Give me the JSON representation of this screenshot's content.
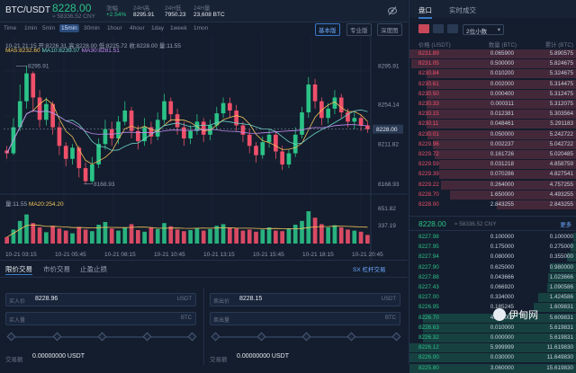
{
  "header": {
    "pair": "BTC/USDT",
    "price": "8228.00",
    "cny": "≈ 58336.52 CNY",
    "change_label": "涨幅",
    "change_value": "+2.54%",
    "high_label": "24H高",
    "high_value": "8295.91",
    "low_label": "24H低",
    "low_value": "7950.23",
    "vol_label": "24H量",
    "vol_value": "23,608 BTC",
    "icon": "eye-slash-icon"
  },
  "timeframes": [
    "Time",
    "1min",
    "5min",
    "15min",
    "30min",
    "1hour",
    "4hour",
    "1day",
    "1week",
    "1mon"
  ],
  "active_timeframe": "15min",
  "view_buttons": [
    "基本版",
    "专业版",
    "深度图"
  ],
  "active_view": "基本版",
  "chart": {
    "ohlc": "10-21 21:15  开:8226.31 高:8228.00 低:8225.72 收:8228.00 量:11.55",
    "ma5": "MA5:8232.60",
    "ma10": "MA10:8239.07",
    "ma30": "MA30:8281.51",
    "high_mark": "8295.91",
    "low_mark": "8168.93",
    "price_ticks": [
      "8295.91",
      "8254.14",
      "8211.82",
      "8168.93"
    ],
    "current_price_tag": "8228.00",
    "volume_label": "量:11.55",
    "volume_ma": "MA20:254.20",
    "volume_ticks": [
      "651.82",
      "337.19"
    ],
    "time_ticks": [
      "10-21 03:15",
      "10-21 05:45",
      "10-21 08:15",
      "10-21 10:45",
      "10-21 13:15",
      "10-21 15:45",
      "10-21 18:15",
      "10-21 20:45"
    ]
  },
  "chart_data": {
    "type": "candlestick",
    "candles": [
      [
        8205,
        8202,
        8210,
        8196
      ],
      [
        8202,
        8230,
        8240,
        8200
      ],
      [
        8230,
        8258,
        8276,
        8226
      ],
      [
        8258,
        8288,
        8296,
        8250
      ],
      [
        8288,
        8262,
        8290,
        8246
      ],
      [
        8262,
        8238,
        8270,
        8230
      ],
      [
        8238,
        8255,
        8262,
        8232
      ],
      [
        8255,
        8230,
        8258,
        8222
      ],
      [
        8230,
        8210,
        8236,
        8200
      ],
      [
        8210,
        8196,
        8214,
        8188
      ],
      [
        8196,
        8208,
        8212,
        8190
      ],
      [
        8208,
        8186,
        8210,
        8176
      ],
      [
        8186,
        8172,
        8192,
        8169
      ],
      [
        8172,
        8190,
        8198,
        8170
      ],
      [
        8190,
        8212,
        8218,
        8186
      ],
      [
        8212,
        8228,
        8238,
        8206
      ],
      [
        8228,
        8218,
        8236,
        8210
      ],
      [
        8218,
        8236,
        8242,
        8212
      ],
      [
        8236,
        8248,
        8258,
        8232
      ],
      [
        8248,
        8226,
        8252,
        8218
      ],
      [
        8226,
        8215,
        8232,
        8206
      ],
      [
        8215,
        8230,
        8240,
        8210
      ],
      [
        8230,
        8220,
        8236,
        8212
      ],
      [
        8220,
        8238,
        8246,
        8216
      ],
      [
        8238,
        8258,
        8266,
        8234
      ],
      [
        8258,
        8244,
        8262,
        8236
      ],
      [
        8244,
        8230,
        8250,
        8222
      ],
      [
        8230,
        8218,
        8236,
        8210
      ],
      [
        8218,
        8226,
        8232,
        8212
      ],
      [
        8226,
        8236,
        8244,
        8222
      ],
      [
        8236,
        8222,
        8240,
        8214
      ],
      [
        8222,
        8232,
        8238,
        8216
      ],
      [
        8232,
        8245,
        8252,
        8228
      ],
      [
        8245,
        8256,
        8262,
        8240
      ],
      [
        8256,
        8248,
        8262,
        8240
      ],
      [
        8248,
        8232,
        8254,
        8226
      ],
      [
        8232,
        8222,
        8236,
        8214
      ],
      [
        8222,
        8210,
        8228,
        8202
      ],
      [
        8210,
        8200,
        8214,
        8192
      ],
      [
        8200,
        8214,
        8220,
        8196
      ],
      [
        8214,
        8222,
        8228,
        8208
      ],
      [
        8222,
        8204,
        8226,
        8196
      ],
      [
        8204,
        8190,
        8210,
        8184
      ],
      [
        8190,
        8202,
        8206,
        8186
      ],
      [
        8202,
        8222,
        8230,
        8198
      ],
      [
        8222,
        8246,
        8252,
        8218
      ],
      [
        8246,
        8276,
        8284,
        8240
      ],
      [
        8276,
        8258,
        8282,
        8250
      ],
      [
        8258,
        8240,
        8262,
        8232
      ],
      [
        8240,
        8250,
        8256,
        8234
      ],
      [
        8250,
        8262,
        8270,
        8244
      ],
      [
        8262,
        8246,
        8266,
        8240
      ],
      [
        8246,
        8236,
        8250,
        8230
      ],
      [
        8236,
        8240,
        8246,
        8228
      ],
      [
        8240,
        8232,
        8244,
        8226
      ],
      [
        8232,
        8228,
        8236,
        8224
      ]
    ],
    "volumes": [
      120,
      260,
      420,
      540,
      380,
      300,
      210,
      330,
      280,
      240,
      190,
      310,
      260,
      230,
      350,
      400,
      280,
      240,
      300,
      360,
      250,
      220,
      300,
      270,
      380,
      320,
      260,
      230,
      250,
      290,
      240,
      270,
      330,
      360,
      300,
      280,
      240,
      260,
      220,
      260,
      300,
      240,
      230,
      280,
      350,
      420,
      600,
      480,
      360,
      300,
      340,
      300,
      260,
      240,
      220,
      160
    ],
    "ylim": [
      8160,
      8305
    ],
    "volume_ylim": [
      0,
      700
    ]
  },
  "order_form": {
    "tabs": [
      "限价交易",
      "市价交易",
      "止盈止损"
    ],
    "active_tab": "限价交易",
    "link": "SX 杠杆交易",
    "buy_price_label": "买入价",
    "buy_price_value": "8228.96",
    "buy_price_unit": "USDT",
    "buy_qty_label": "买入量",
    "buy_qty_unit": "BTC",
    "sell_price_label": "卖出价",
    "sell_price_value": "8228.15",
    "sell_price_unit": "USDT",
    "sell_qty_label": "卖出量",
    "sell_qty_unit": "BTC",
    "buy_total_label": "交易额",
    "buy_total_value": "0.00000000 USDT",
    "sell_total_label": "交易额",
    "sell_total_value": "0.00000000 USDT"
  },
  "book": {
    "tabs": [
      "盘口",
      "实时成交"
    ],
    "active_tab": "盘口",
    "decimals": "2位小数",
    "col_price": "价格 (USDT)",
    "col_qty": "数量 (BTC)",
    "col_total": "累计 (BTC)",
    "asks": [
      [
        "8231.89",
        "0.065900",
        "5.890575",
        1.0
      ],
      [
        "8231.05",
        "0.500000",
        "5.824675",
        0.99
      ],
      [
        "8230.84",
        "0.010200",
        "5.324675",
        0.9
      ],
      [
        "8230.61",
        "0.002000",
        "5.314475",
        0.9
      ],
      [
        "8230.50",
        "0.000400",
        "5.312475",
        0.9
      ],
      [
        "8230.33",
        "0.000311",
        "5.312075",
        0.9
      ],
      [
        "8230.15",
        "0.012381",
        "5.303564",
        0.9
      ],
      [
        "8230.11",
        "0.048461",
        "5.291183",
        0.9
      ],
      [
        "8230.01",
        "0.050000",
        "5.242722",
        0.89
      ],
      [
        "8229.96",
        "0.002237",
        "5.042722",
        0.86
      ],
      [
        "8229.72",
        "0.161726",
        "5.020485",
        0.85
      ],
      [
        "8229.59",
        "0.031218",
        "4.858759",
        0.82
      ],
      [
        "8229.39",
        "0.070286",
        "4.827541",
        0.82
      ],
      [
        "8229.22",
        "0.264000",
        "4.757255",
        0.81
      ],
      [
        "8228.70",
        "1.650000",
        "4.493255",
        0.76
      ],
      [
        "8228.00",
        "2.843255",
        "2.843255",
        0.48
      ]
    ],
    "mid_price": "8228.00",
    "mid_cny": "≈ 58336.52 CNY",
    "more": "更多",
    "bids": [
      [
        "8227.98",
        "0.100000",
        "0.100000",
        0.02
      ],
      [
        "8227.95",
        "0.175000",
        "0.275000",
        0.04
      ],
      [
        "8227.94",
        "0.080000",
        "0.355000",
        0.06
      ],
      [
        "8227.90",
        "0.625000",
        "0.980000",
        0.16
      ],
      [
        "8227.88",
        "0.043666",
        "1.023666",
        0.17
      ],
      [
        "8227.43",
        "0.066920",
        "1.090586",
        0.18
      ],
      [
        "8227.00",
        "0.334000",
        "1.424586",
        0.23
      ],
      [
        "8226.95",
        "0.185245",
        "1.609831",
        0.26
      ],
      [
        "8226.70",
        "4.000000",
        "5.609831",
        0.92
      ],
      [
        "8226.63",
        "0.010000",
        "5.619831",
        0.92
      ],
      [
        "8226.32",
        "0.000000",
        "5.619831",
        0.92
      ],
      [
        "8226.12",
        "5.999999",
        "11.619830",
        1.0
      ],
      [
        "8226.00",
        "0.030000",
        "11.649830",
        1.0
      ],
      [
        "8225.80",
        "3.060000",
        "15.619830",
        1.0
      ]
    ]
  },
  "watermark": "伊甸网",
  "colors": {
    "up": "#2bc287",
    "down": "#f0506a",
    "bg": "#131d2d",
    "accent": "#3a78c8"
  }
}
